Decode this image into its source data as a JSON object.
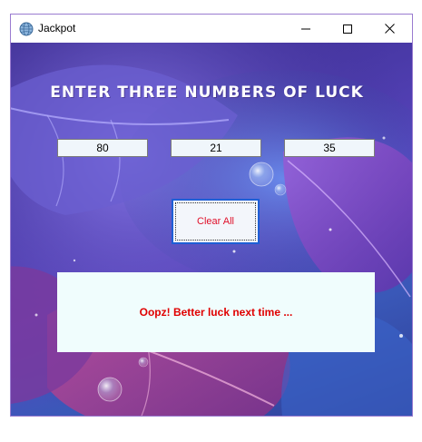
{
  "window": {
    "title": "Jackpot",
    "controls": {
      "minimize_icon": "minimize-icon",
      "maximize_icon": "maximize-icon",
      "close_icon": "close-icon"
    }
  },
  "main": {
    "heading": "ENTER THREE NUMBERS OF LUCK",
    "inputs": [
      {
        "value": "80"
      },
      {
        "value": "21"
      },
      {
        "value": "35"
      }
    ],
    "clear_button_label": "Clear All",
    "result_message": "Oopz! Better luck next time ..."
  },
  "colors": {
    "button_text": "#e0102a",
    "result_text": "#e00000",
    "button_border": "#1e5fd6",
    "window_border": "#9a7bd0",
    "result_panel_bg": "#f0fdfd"
  }
}
